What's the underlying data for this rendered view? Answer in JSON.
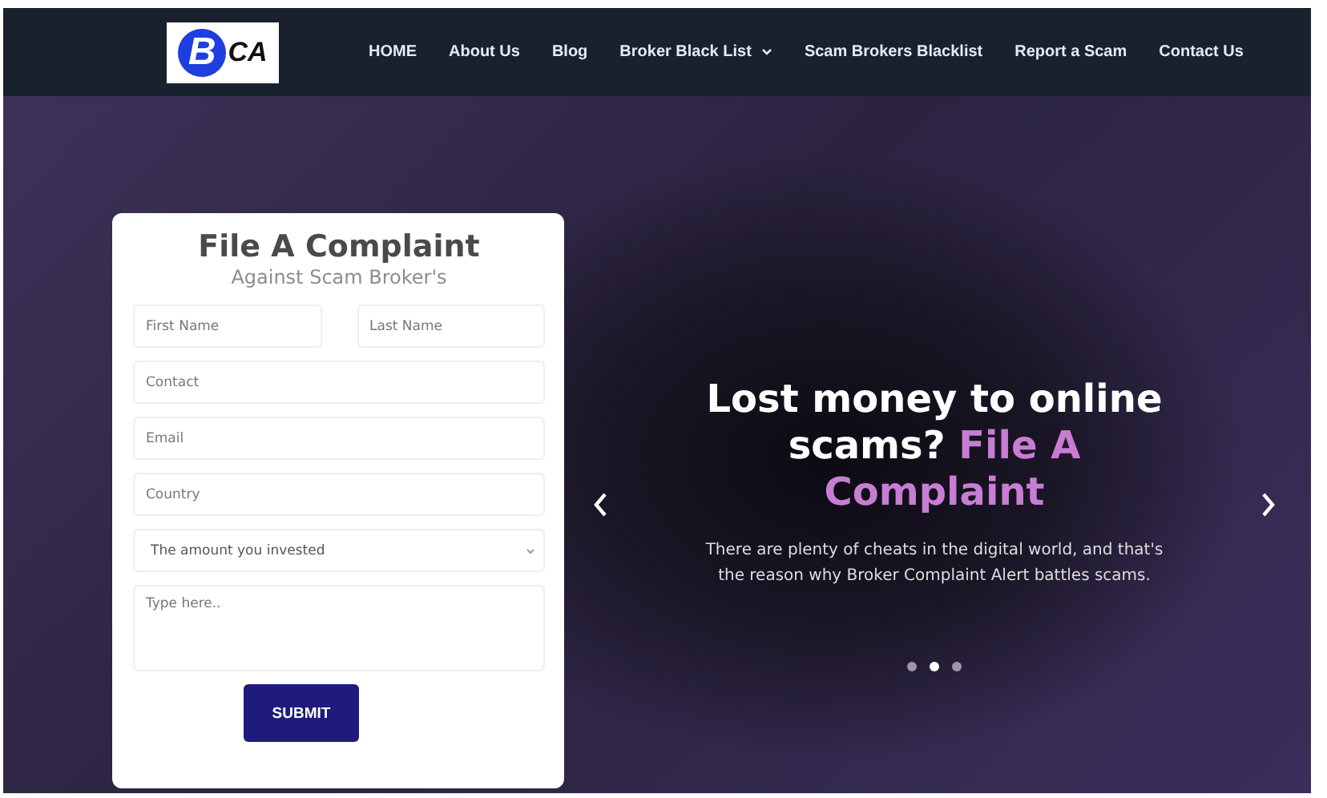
{
  "logo": {
    "letter": "B",
    "rest": "CA"
  },
  "nav": [
    {
      "label": "HOME",
      "has_dropdown": false
    },
    {
      "label": "About Us",
      "has_dropdown": false
    },
    {
      "label": "Blog",
      "has_dropdown": false
    },
    {
      "label": "Broker Black List",
      "has_dropdown": true
    },
    {
      "label": "Scam Brokers Blacklist",
      "has_dropdown": false
    },
    {
      "label": "Report a Scam",
      "has_dropdown": false
    },
    {
      "label": "Contact Us",
      "has_dropdown": false
    }
  ],
  "form": {
    "title": "File A Complaint",
    "subtitle": "Against Scam Broker's",
    "name_fields": [
      {
        "placeholder": "First Name"
      },
      {
        "placeholder": "Last Name"
      }
    ],
    "fields": [
      {
        "placeholder": "Contact"
      },
      {
        "placeholder": "Email"
      },
      {
        "placeholder": "Country"
      }
    ],
    "select": {
      "value": "The amount you invested"
    },
    "message": {
      "placeholder": "Type here.."
    },
    "submit": "SUBMIT"
  },
  "hero": {
    "headline": "Lost money to online scams?",
    "headline_highlight": "File A Complaint",
    "text": "There are plenty of cheats in the digital world, and that's the reason why Broker Complaint Alert battles scams.",
    "dots": [
      {
        "selected": false
      },
      {
        "selected": true
      },
      {
        "selected": false
      }
    ]
  }
}
